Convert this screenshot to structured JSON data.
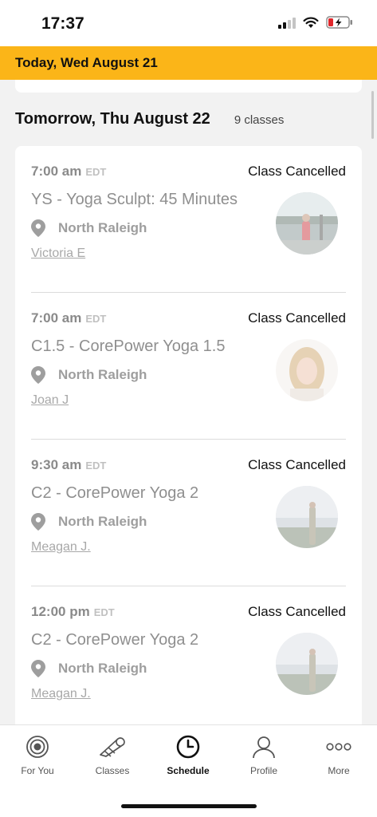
{
  "status_bar": {
    "time": "17:37"
  },
  "today_banner": {
    "label": "Today, Wed August 21"
  },
  "schedule": {
    "day_title": "Tomorrow, Thu August 22",
    "class_count": "9 classes",
    "classes": [
      {
        "time": "7:00 am",
        "tz": "EDT",
        "status": "Class Cancelled",
        "name": "YS - Yoga Sculpt: 45 Minutes",
        "location": "North Raleigh",
        "instructor": "Victoria E"
      },
      {
        "time": "7:00 am",
        "tz": "EDT",
        "status": "Class Cancelled",
        "name": "C1.5 - CorePower Yoga 1.5",
        "location": "North Raleigh",
        "instructor": "Joan J"
      },
      {
        "time": "9:30 am",
        "tz": "EDT",
        "status": "Class Cancelled",
        "name": "C2 - CorePower Yoga 2",
        "location": "North Raleigh",
        "instructor": "Meagan J."
      },
      {
        "time": "12:00 pm",
        "tz": "EDT",
        "status": "Class Cancelled",
        "name": "C2 - CorePower Yoga 2",
        "location": "North Raleigh",
        "instructor": "Meagan J."
      }
    ]
  },
  "tab_bar": {
    "tabs": [
      {
        "label": "For You",
        "icon": "target-icon"
      },
      {
        "label": "Classes",
        "icon": "yoga-mat-icon"
      },
      {
        "label": "Schedule",
        "icon": "clock-icon"
      },
      {
        "label": "Profile",
        "icon": "person-icon"
      },
      {
        "label": "More",
        "icon": "more-dots-icon"
      }
    ],
    "active": "Schedule"
  },
  "colors": {
    "accent": "#fbb518",
    "background": "#f2f2f2",
    "card": "#ffffff"
  }
}
